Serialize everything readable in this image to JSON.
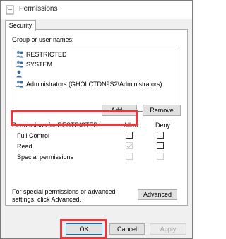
{
  "window": {
    "title": "Permissions",
    "icon": "folder-icon"
  },
  "tabs": [
    {
      "label": "Security"
    }
  ],
  "group_section": {
    "label": "Group or user names:",
    "items": [
      {
        "name": "RESTRICTED",
        "icon": "users-icon"
      },
      {
        "name": "SYSTEM",
        "icon": "users-icon"
      },
      {
        "name": "",
        "icon": "user-icon"
      },
      {
        "name": "Administrators (GHOLCTDN9S2\\Administrators)",
        "icon": "users-icon"
      }
    ],
    "add_label": "Add...",
    "remove_label": "Remove"
  },
  "permissions": {
    "header": "Permissions for RESTRICTED",
    "allow_label": "Allow",
    "deny_label": "Deny",
    "rows": [
      {
        "name": "Full Control",
        "allow": false,
        "deny": false
      },
      {
        "name": "Read",
        "allow": true,
        "deny": false
      },
      {
        "name": "Special permissions",
        "allow": false,
        "deny": false
      }
    ]
  },
  "advanced": {
    "text": "For special permissions or advanced settings, click Advanced.",
    "button_label": "Advanced"
  },
  "footer": {
    "ok_label": "OK",
    "cancel_label": "Cancel",
    "apply_label": "Apply"
  },
  "colors": {
    "highlight": "#e8383d",
    "accent": "#0078d7"
  }
}
